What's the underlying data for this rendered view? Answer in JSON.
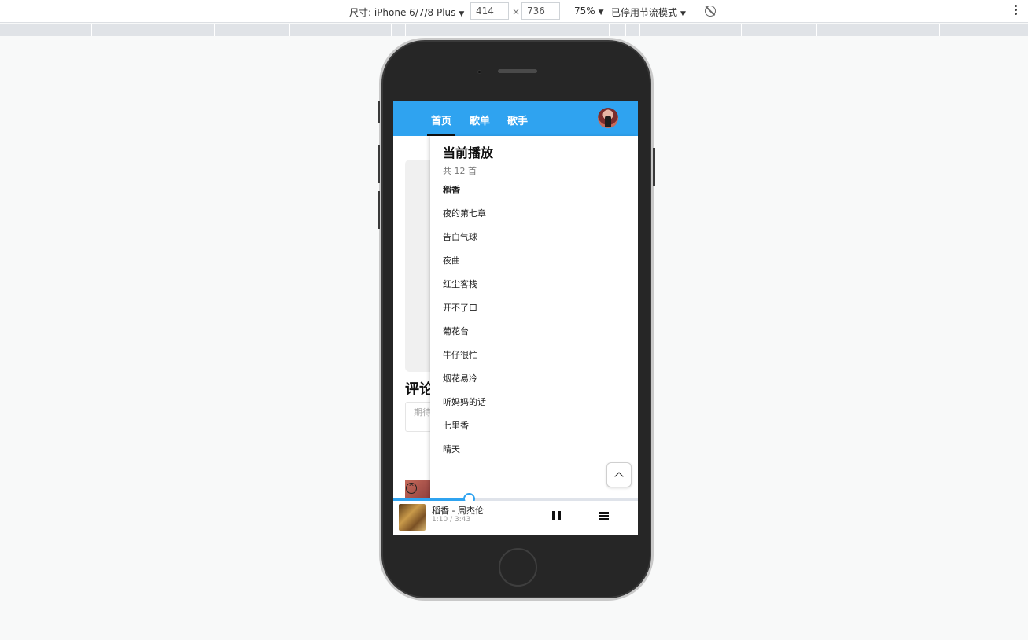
{
  "devtools": {
    "device_label": "尺寸: iPhone 6/7/8 Plus",
    "width_value": "414",
    "height_value": "736",
    "times_symbol": "×",
    "zoom": "75%",
    "throttle": "已停用节流模式",
    "caret": "▼"
  },
  "app": {
    "nav": [
      {
        "label": "首页",
        "active": true
      },
      {
        "label": "歌单",
        "active": false
      },
      {
        "label": "歌手",
        "active": false
      }
    ]
  },
  "background": {
    "comment_title": "评论",
    "comment_placeholder": "期待你的评论"
  },
  "playlist": {
    "title": "当前播放",
    "count": "共 12 首",
    "items": [
      "稻香",
      "夜的第七章",
      "告白气球",
      "夜曲",
      "红尘客栈",
      "开不了口",
      "菊花台",
      "牛仔很忙",
      "烟花易冷",
      "听妈妈的话",
      "七里香",
      "晴天"
    ],
    "active_index": 0
  },
  "player": {
    "title": "稻香 - 周杰伦",
    "time": "1:10 / 3:43",
    "progress": 0.31
  },
  "colors": {
    "accent": "#2fa3f0",
    "device_frame": "#262626"
  },
  "icons": [
    "rotate-icon",
    "kebab-menu-icon",
    "chevron-up-icon",
    "pause-icon",
    "playlist-menu-icon",
    "user-avatar"
  ]
}
